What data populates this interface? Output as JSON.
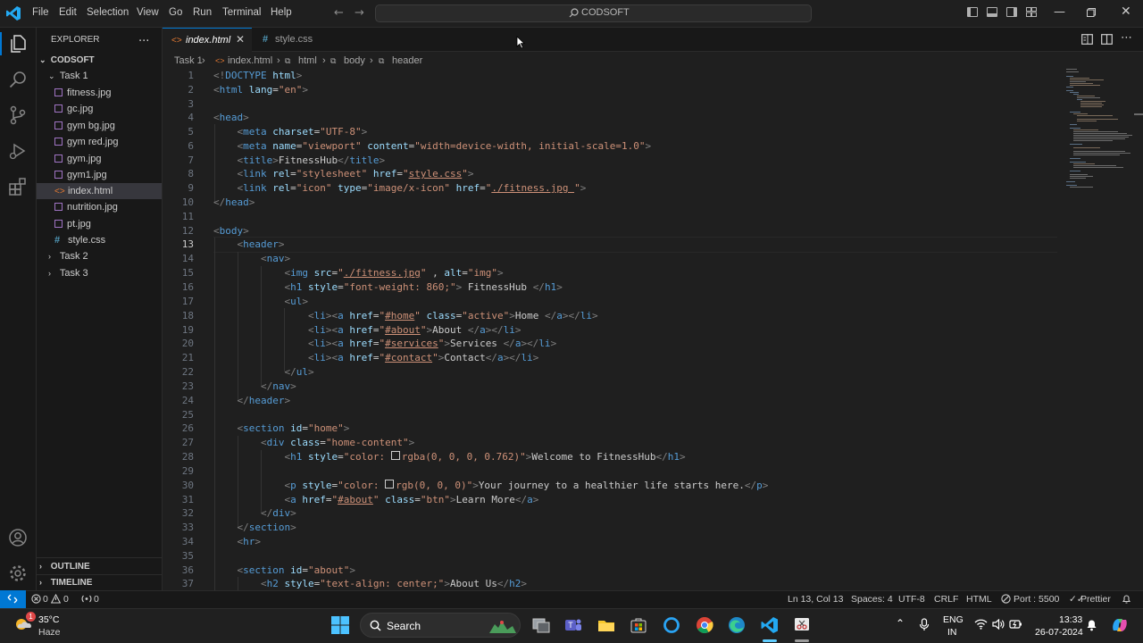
{
  "titlebar": {
    "menu": [
      "File",
      "Edit",
      "Selection",
      "View",
      "Go",
      "Run",
      "Terminal",
      "Help"
    ],
    "command_center": "CODSOFT",
    "colors": {
      "accent": "#0078d4",
      "bg": "#1f1f1f"
    }
  },
  "sidebar": {
    "title": "EXPLORER",
    "more": "...",
    "root": "CODSOFT",
    "folders": [
      {
        "label": "Task 1",
        "expanded": true,
        "files": [
          {
            "label": "fitness.jpg",
            "type": "image"
          },
          {
            "label": "gc.jpg",
            "type": "image"
          },
          {
            "label": "gym bg.jpg",
            "type": "image"
          },
          {
            "label": "gym red.jpg",
            "type": "image"
          },
          {
            "label": "gym.jpg",
            "type": "image"
          },
          {
            "label": "gym1.jpg",
            "type": "image"
          },
          {
            "label": "index.html",
            "type": "html",
            "selected": true
          },
          {
            "label": "nutrition.jpg",
            "type": "image"
          },
          {
            "label": "pt.jpg",
            "type": "image"
          },
          {
            "label": "style.css",
            "type": "css"
          }
        ]
      },
      {
        "label": "Task 2",
        "expanded": false
      },
      {
        "label": "Task 3",
        "expanded": false
      }
    ],
    "outline": "OUTLINE",
    "timeline": "TIMELINE"
  },
  "tabs": [
    {
      "label": "index.html",
      "icon": "<>",
      "active": true
    },
    {
      "label": "style.css",
      "icon": "#",
      "active": false
    }
  ],
  "breadcrumb": [
    "Task 1",
    "index.html",
    "html",
    "body",
    "header"
  ],
  "editor": {
    "current_line": 13,
    "line_numbers": [
      "1",
      "2",
      "3",
      "4",
      "5",
      "6",
      "7",
      "8",
      "9",
      "10",
      "11",
      "12",
      "13",
      "14",
      "15",
      "16",
      "17",
      "18",
      "19",
      "20",
      "21",
      "22",
      "23",
      "24",
      "25",
      "26",
      "27",
      "28",
      "29",
      "30",
      "31",
      "32",
      "33",
      "34",
      "35",
      "36",
      "37"
    ]
  },
  "statusbar": {
    "errors": "0",
    "warnings": "0",
    "ports_count": "0",
    "position": "Ln 13, Col 13",
    "spaces": "Spaces: 4",
    "encoding": "UTF-8",
    "eol": "CRLF",
    "language": "HTML",
    "port": "Port : 5500",
    "formatter": "Prettier"
  },
  "taskbar": {
    "weather_temp": "35°C",
    "weather_desc": "Haze",
    "weather_badge": "1",
    "search": "Search",
    "lang": "ENG",
    "region": "IN",
    "time": "13:33",
    "date": "26-07-2024"
  }
}
